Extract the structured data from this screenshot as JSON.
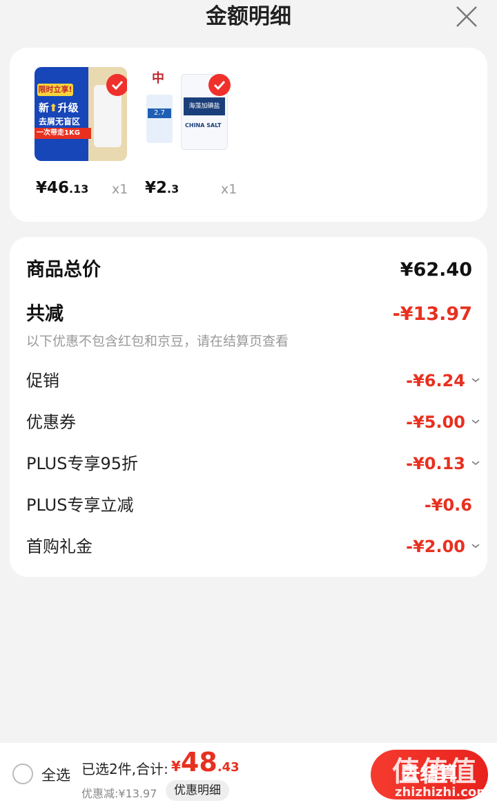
{
  "header": {
    "title": "金额明细"
  },
  "products": [
    {
      "image_text": [
        "限时立享!",
        "新",
        "升级",
        "去屑无盲区",
        "一次带走1KG"
      ],
      "price_int": "¥46",
      "price_frac": ".13",
      "qty": "x1"
    },
    {
      "image_text": [
        "中",
        "2.7",
        "海藻加碘盐",
        "CHINA SALT"
      ],
      "price_int": "¥2",
      "price_frac": ".3",
      "qty": "x1"
    }
  ],
  "detail": {
    "total_label": "商品总价",
    "total_value": "¥62.40",
    "reduce_label": "共减",
    "reduce_value": "-¥13.97",
    "note": "以下优惠不包含红包和京豆，请在结算页查看",
    "items": [
      {
        "label": "促销",
        "value": "-¥6.24",
        "expandable": true
      },
      {
        "label": "优惠券",
        "value": "-¥5.00",
        "expandable": true
      },
      {
        "label": "PLUS专享95折",
        "value": "-¥0.13",
        "expandable": true
      },
      {
        "label": "PLUS专享立减",
        "value": "-¥0.6",
        "expandable": false
      },
      {
        "label": "首购礼金",
        "value": "-¥2.00",
        "expandable": true
      }
    ]
  },
  "bottom": {
    "select_all": "全选",
    "summary": "已选2件,合计:",
    "total_yen": "¥",
    "total_int": "48",
    "total_frac": ".43",
    "discount": "优惠减:¥13.97",
    "detail_btn": "优惠明细",
    "checkout": "去结算",
    "watermark_cn": "值值值",
    "watermark_url": "zhizhizhi.com"
  },
  "colors": {
    "accent": "#e8301f",
    "brand_red": "#f0302b"
  }
}
